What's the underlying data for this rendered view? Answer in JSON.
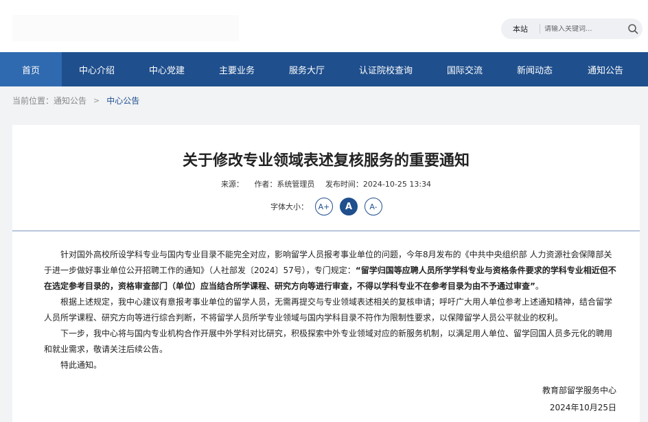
{
  "search": {
    "scope": "本站",
    "placeholder": "请输入关键词..."
  },
  "nav": {
    "items": [
      "首页",
      "中心介绍",
      "中心党建",
      "主要业务",
      "服务大厅",
      "认证院校查询",
      "国际交流",
      "新闻动态",
      "通知公告"
    ],
    "active_index": 0
  },
  "breadcrumb": {
    "prefix": "当前位置：",
    "level1": "通知公告",
    "separator": ">",
    "level2": "中心公告"
  },
  "article": {
    "title": "关于修改专业领域表述复核服务的重要通知",
    "source_label": "来源：",
    "author": "作者：系统管理员",
    "publish_time": "发布时间：2024-10-25 13:34",
    "font_size_label": "字体大小：",
    "font_buttons": [
      "A+",
      "A",
      "A-"
    ],
    "p1_normal": "针对国外高校所设学科专业与国内专业目录不能完全对应，影响留学人员报考事业单位的问题，今年8月发布的《中共中央组织部 人力资源社会保障部关于进一步做好事业单位公开招聘工作的通知》（人社部发〔2024〕57号），专门规定：",
    "p1_bold": "“留学归国等应聘人员所学学科专业与资格条件要求的学科专业相近但不在选定参考目录的，资格审查部门（单位）应当结合所学课程、研究方向等进行审查，不得以学科专业不在参考目录为由不予通过审查”",
    "p1_end": "。",
    "p2": "根据上述规定，我中心建议有意报考事业单位的留学人员，无需再提交与专业领域表述相关的复核申请；呼吁广大用人单位参考上述通知精神，结合留学人员所学课程、研究方向等进行综合判断，不将留学人员所学专业领域与国内学科目录不符作为限制性要求，以保障留学人员公平就业的权利。",
    "p3": "下一步，我中心将与国内专业机构合作开展中外学科对比研究，积极探索中外专业领域对应的新服务机制，以满足用人单位、留学回国人员多元化的聘用和就业需求，敬请关注后续公告。",
    "p4": "特此通知。",
    "signature": "教育部留学服务中心",
    "date": "2024年10月25日"
  }
}
